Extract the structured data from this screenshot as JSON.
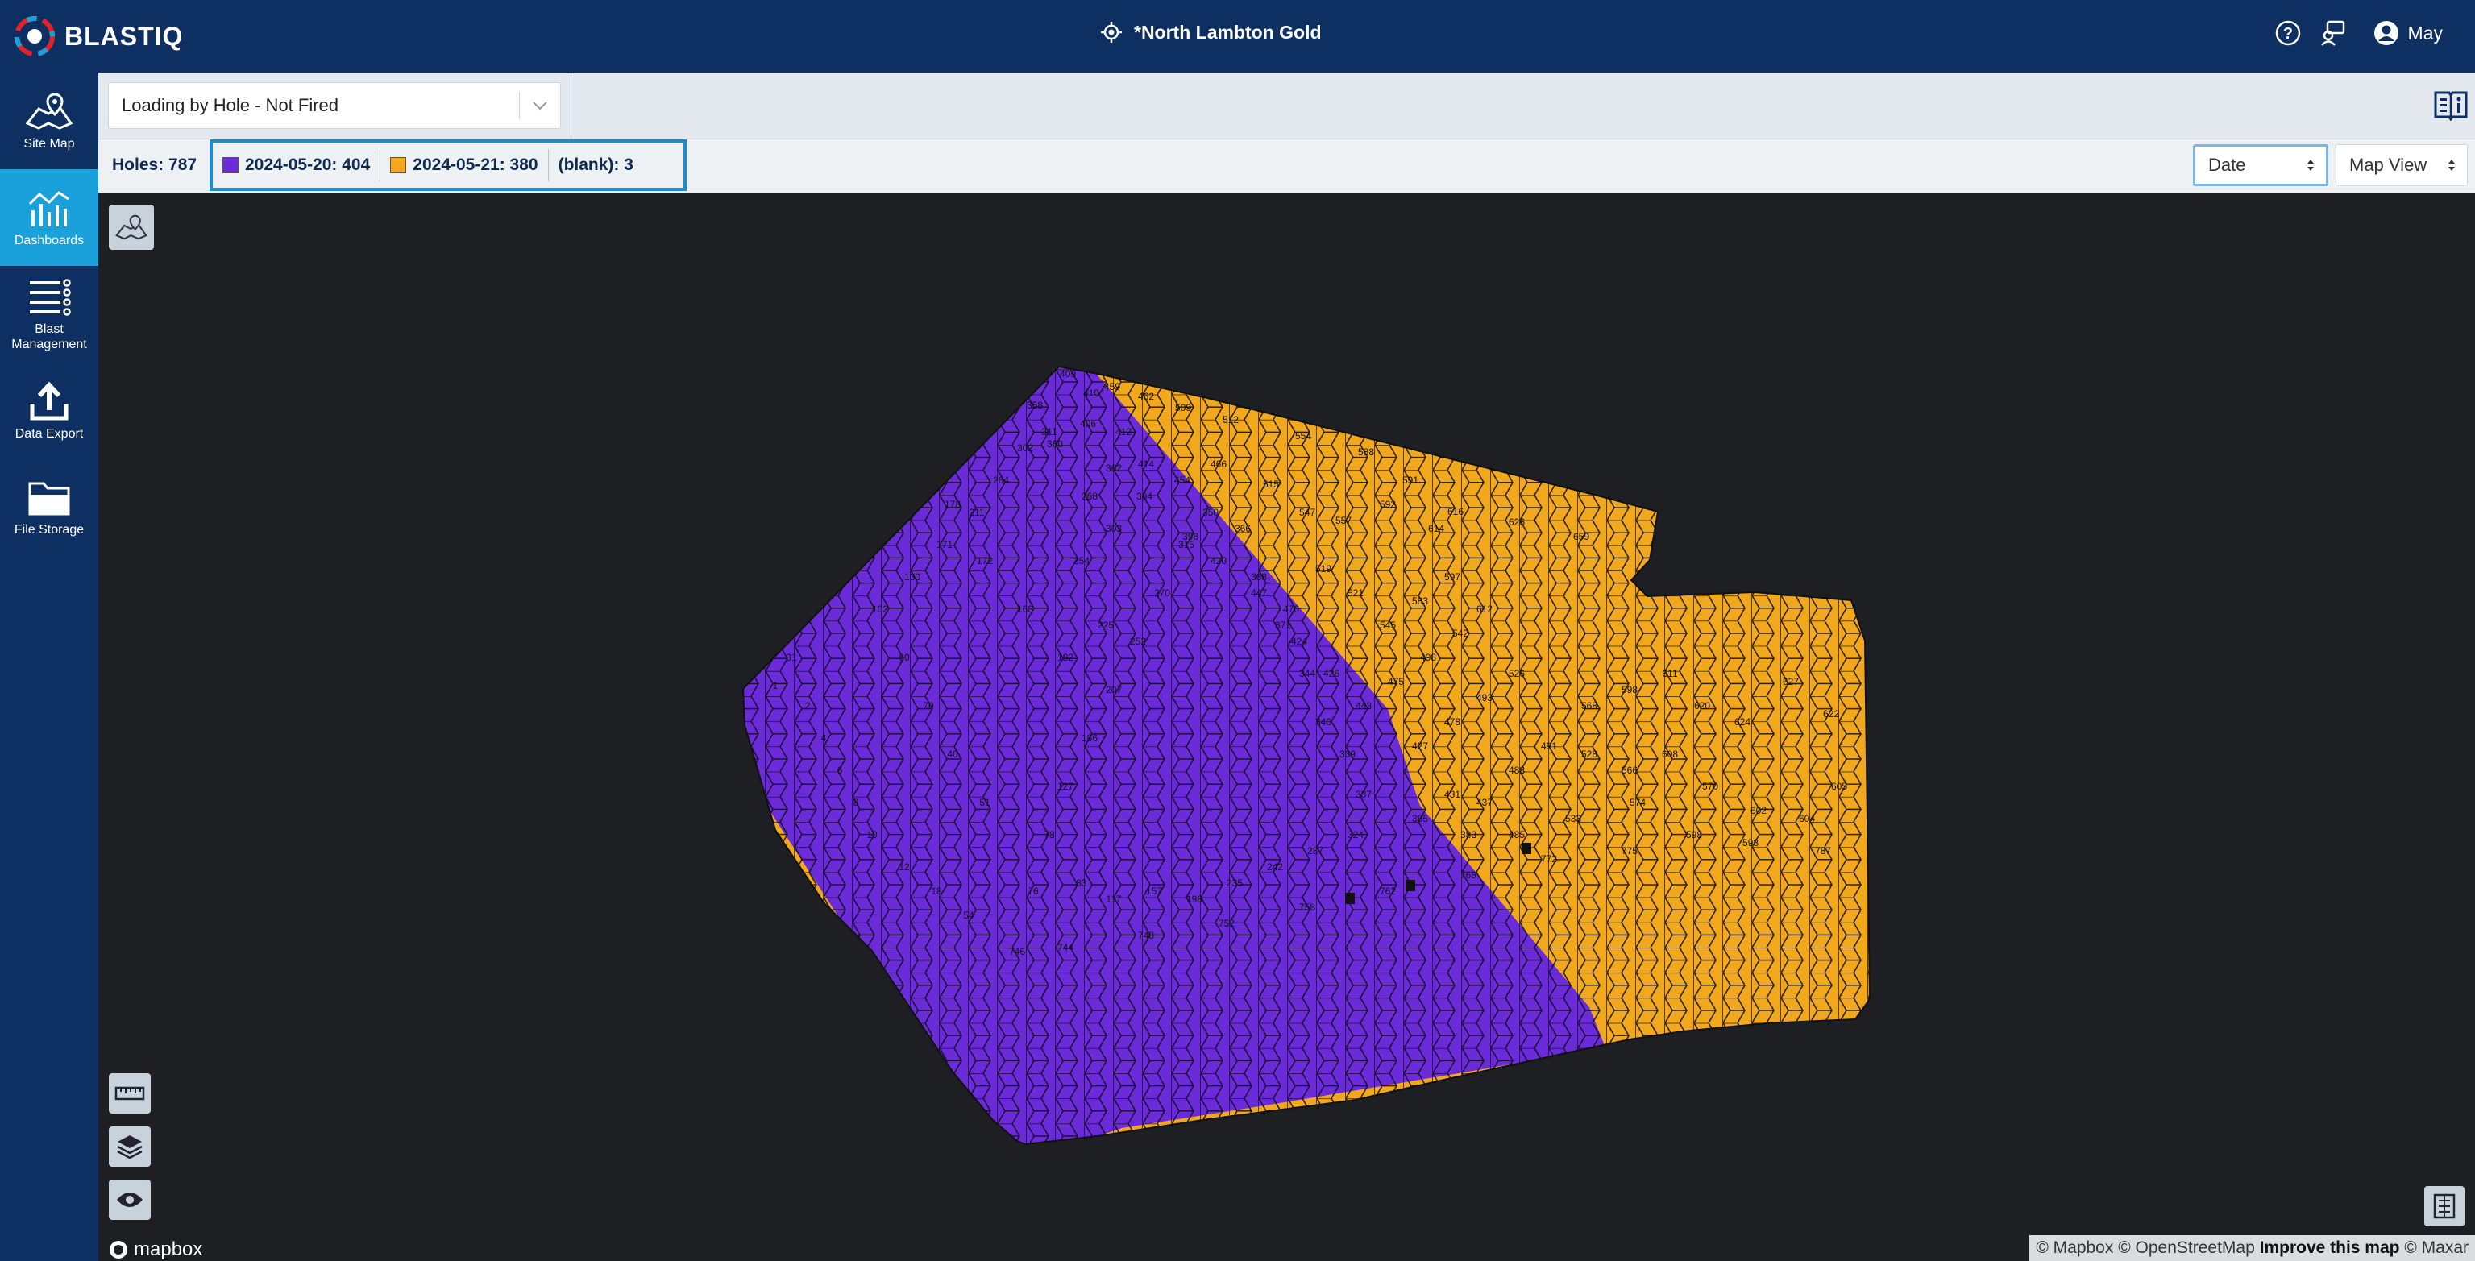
{
  "app": {
    "name": "BLASTIQ"
  },
  "header": {
    "site_name": "*North Lambton Gold",
    "user_name": "May"
  },
  "sidebar": {
    "items": [
      {
        "label": "Site Map",
        "icon": "map-icon"
      },
      {
        "label": "Dashboards",
        "icon": "dashboard-icon",
        "active": true
      },
      {
        "label": "Blast Management",
        "icon": "list-icon"
      },
      {
        "label": "Data Export",
        "icon": "upload-icon"
      },
      {
        "label": "File Storage",
        "icon": "folder-icon"
      }
    ]
  },
  "filter": {
    "dashboard_select": "Loading by Hole - Not Fired"
  },
  "legend": {
    "holes": "Holes: 787",
    "items": [
      {
        "label": "2024-05-20: 404",
        "color": "#6c2bd9"
      },
      {
        "label": "2024-05-21: 380",
        "color": "#f2a81d"
      },
      {
        "label": "(blank): 3"
      }
    ]
  },
  "controls": {
    "color_by": "Date",
    "view": "Map View"
  },
  "map": {
    "blast_polygon": "blast-pattern",
    "mapbox_label": "mapbox",
    "attribution": {
      "prefix": "© Mapbox © OpenStreetMap",
      "link": "Improve this map",
      "suffix": "© Maxar"
    }
  }
}
